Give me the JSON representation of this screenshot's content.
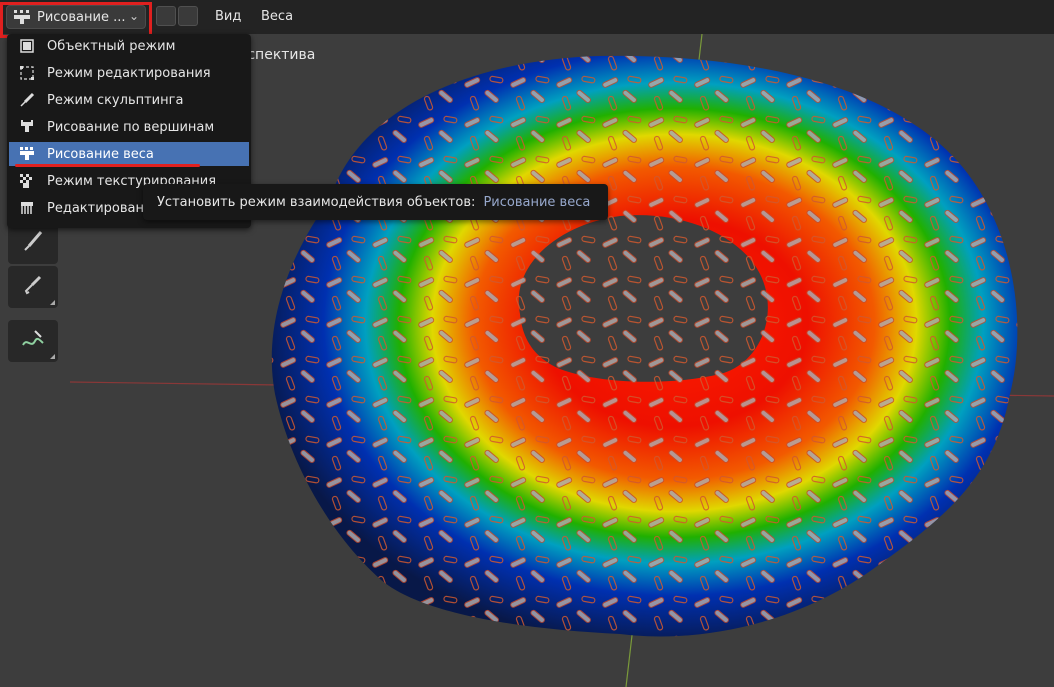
{
  "header": {
    "mode_label": "Рисование ...",
    "menus": [
      "Вид",
      "Веса"
    ]
  },
  "mode_menu": {
    "items": [
      {
        "label": "Объектный режим",
        "icon": "object-mode-icon"
      },
      {
        "label": "Режим редактирования",
        "icon": "edit-mode-icon"
      },
      {
        "label": "Режим скульптинга",
        "icon": "sculpt-mode-icon"
      },
      {
        "label": "Рисование по вершинам",
        "icon": "vertex-paint-icon"
      },
      {
        "label": "Рисование веса",
        "icon": "weight-paint-icon",
        "active": true
      },
      {
        "label": "Режим текстурирования",
        "icon": "texture-paint-icon"
      },
      {
        "label": "Редактирование волос",
        "icon": "particle-edit-icon"
      }
    ]
  },
  "tooltip": {
    "text": "Установить режим взаимодействия объектов:",
    "value": "Рисование веса"
  },
  "viewport": {
    "title": "Пользовательская перспектива"
  },
  "tools": [
    "draw-brush-icon",
    "sample-weight-icon",
    "annotate-icon"
  ],
  "colors": {
    "accent": "#4772b3",
    "highlight": "#e0201f",
    "header_bg": "#232323",
    "viewport_bg": "#3d3d3d"
  }
}
